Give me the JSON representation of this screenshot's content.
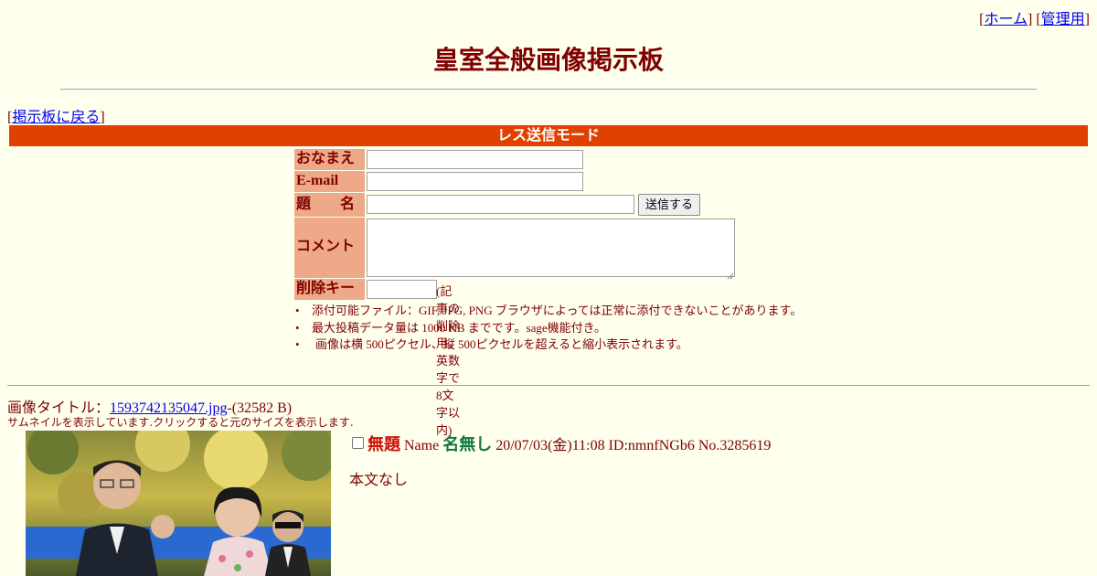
{
  "header": {
    "links": [
      {
        "label": "ホーム"
      },
      {
        "label": "管理用"
      }
    ],
    "title": "皇室全般画像掲示板"
  },
  "nav": {
    "back_label": "掲示板に戻る"
  },
  "form": {
    "mode_label": "レス送信モード",
    "name_label": "おなまえ",
    "email_label": "E-mail",
    "subject_label": "題　　名",
    "submit_label": "送信する",
    "comment_label": "コメント",
    "delkey_label": "削除キー",
    "delkey_hint": "(記事の削除用。英数字で8文字以内)",
    "name_value": "",
    "email_value": "",
    "subject_value": "",
    "comment_value": "",
    "delkey_value": ""
  },
  "notes": [
    "添付可能ファイル：GIF, JPG, PNG ブラウザによっては正常に添付できないことがあります。",
    "最大投稿データ量は 1000 KB までです。sage機能付き。",
    "画像は横 500ピクセル、縦 500ピクセルを超えると縮小表示されます。"
  ],
  "post": {
    "image_title_prefix": "画像タイトル：",
    "image_filename": "1593742135047.jpg",
    "image_size": "-(32582 B)",
    "thumb_note": "サムネイルを表示しています.クリックすると元のサイズを表示します.",
    "subject": "無題",
    "name_prefix": "Name",
    "name": "名無し",
    "meta": "20/07/03(金)11:08 ID:nmnfNGb6 No.3285619",
    "body": "本文なし"
  },
  "colors": {
    "background": "#ffffee",
    "text": "#800000",
    "mode_bar": "#e04000",
    "label_bg": "#eeaa88",
    "subject": "#cc1105",
    "name": "#117743",
    "link": "#0000ee"
  }
}
